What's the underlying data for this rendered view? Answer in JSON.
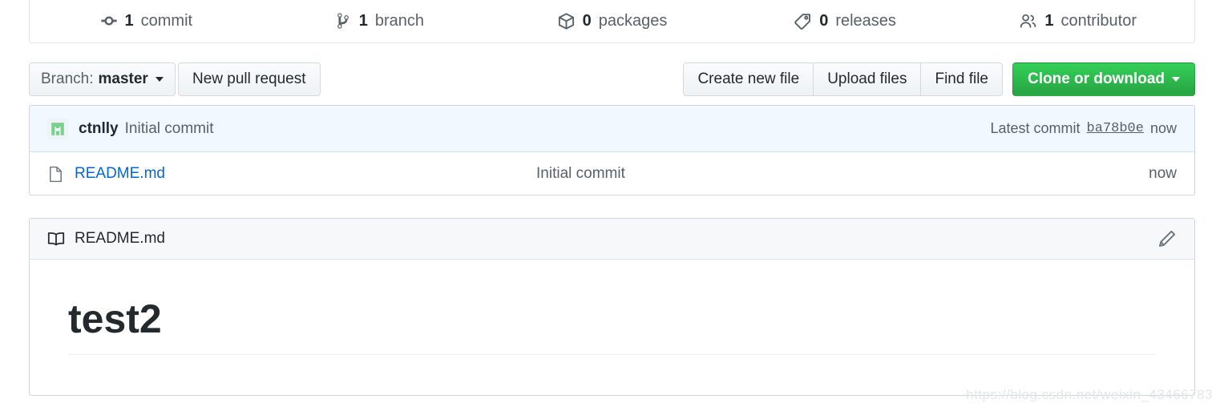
{
  "stats": [
    {
      "icon": "commit-icon",
      "count": "1",
      "label": "commit",
      "name": "stat-commits"
    },
    {
      "icon": "branch-icon",
      "count": "1",
      "label": "branch",
      "name": "stat-branches"
    },
    {
      "icon": "package-icon",
      "count": "0",
      "label": "packages",
      "name": "stat-packages"
    },
    {
      "icon": "tag-icon",
      "count": "0",
      "label": "releases",
      "name": "stat-releases"
    },
    {
      "icon": "people-icon",
      "count": "1",
      "label": "contributor",
      "name": "stat-contributors"
    }
  ],
  "toolbar": {
    "branch_label": "Branch:",
    "branch_value": "master",
    "new_pull_request": "New pull request",
    "create_new_file": "Create new file",
    "upload_files": "Upload files",
    "find_file": "Find file",
    "clone_or_download": "Clone or download"
  },
  "commit_bar": {
    "author": "ctnlly",
    "message": "Initial commit",
    "latest_commit_label": "Latest commit",
    "sha": "ba78b0e",
    "time": "now"
  },
  "files": [
    {
      "icon": "file-icon",
      "name": "README.md",
      "message": "Initial commit",
      "time": "now"
    }
  ],
  "readme": {
    "icon": "book-icon",
    "title": "README.md",
    "edit_icon": "pencil-icon",
    "heading": "test2"
  },
  "watermark": "https://blog.csdn.net/weixin_43466783",
  "colors": {
    "accent_green": "#28a745",
    "link_blue": "#0366d6",
    "commit_bar_bg": "#f1f8ff",
    "panel_header_bg": "#f6f8fa",
    "border": "#d1d5da",
    "muted_text": "#586069"
  }
}
